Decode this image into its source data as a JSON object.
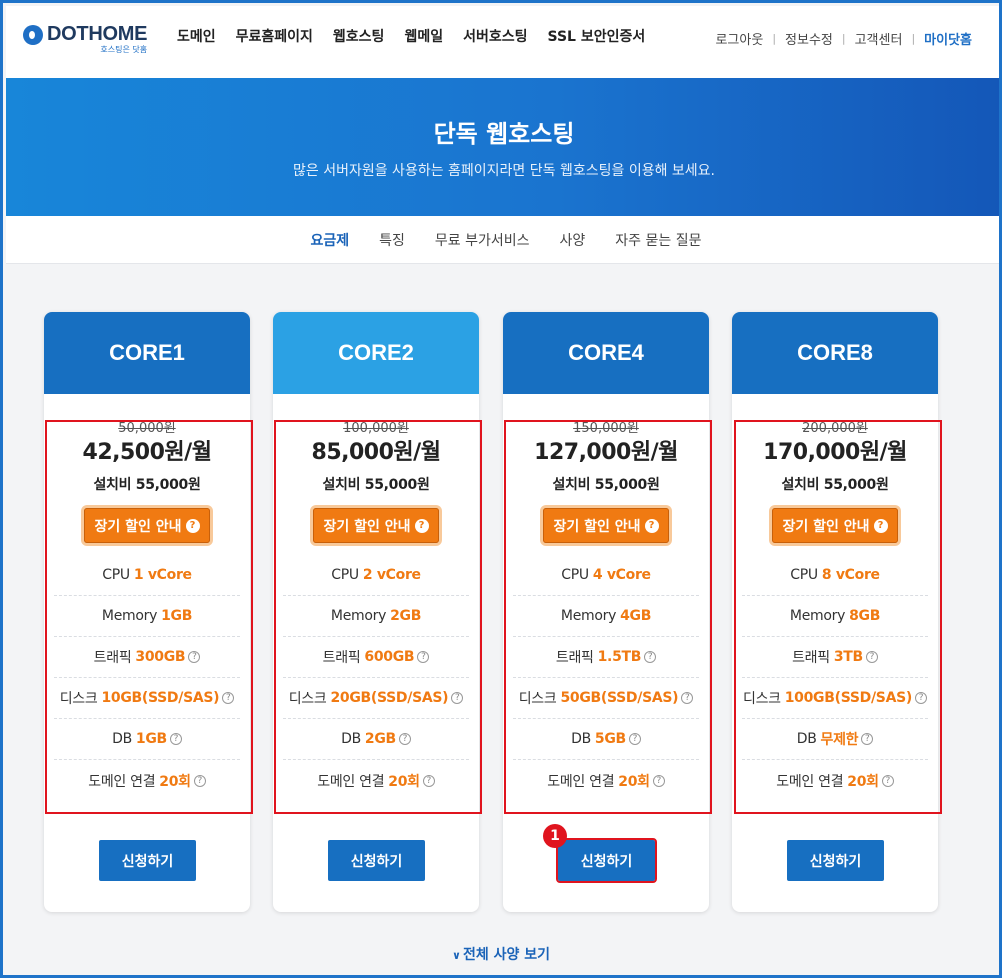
{
  "header": {
    "logo": {
      "word": "DOTHOME",
      "sub": "호스팅은 닷홈"
    },
    "nav": [
      "도메인",
      "무료홈페이지",
      "웹호스팅",
      "웹메일",
      "서버호스팅",
      "SSL 보안인증서"
    ],
    "util": {
      "logout": "로그아웃",
      "edit_info": "정보수정",
      "support": "고객센터",
      "my": "마이닷홈"
    }
  },
  "hero": {
    "title": "단독 웹호스팅",
    "subtitle": "많은 서버자원을 사용하는 홈페이지라면 단독 웹호스팅을 이용해 보세요."
  },
  "tabs": [
    "요금제",
    "특징",
    "무료 부가서비스",
    "사양",
    "자주 묻는 질문"
  ],
  "active_tab": "요금제",
  "labels": {
    "discount_button": "장기 할인 안내",
    "cpu": "CPU",
    "memory": "Memory",
    "traffic": "트래픽",
    "disk": "디스크",
    "db": "DB",
    "domain": "도메인 연결",
    "apply": "신청하기",
    "view_all": "전체 사양 보기"
  },
  "plans": [
    {
      "name": "CORE1",
      "original_price": "50,000원",
      "price": "42,500원/월",
      "setup": "설치비 55,000원",
      "cpu": "1 vCore",
      "memory": "1GB",
      "traffic": "300GB",
      "disk": "10GB(SSD/SAS)",
      "db": "1GB",
      "domain": "20회"
    },
    {
      "name": "CORE2",
      "original_price": "100,000원",
      "price": "85,000원/월",
      "setup": "설치비 55,000원",
      "cpu": "2 vCore",
      "memory": "2GB",
      "traffic": "600GB",
      "disk": "20GB(SSD/SAS)",
      "db": "2GB",
      "domain": "20회"
    },
    {
      "name": "CORE4",
      "original_price": "150,000원",
      "price": "127,000원/월",
      "setup": "설치비 55,000원",
      "cpu": "4 vCore",
      "memory": "4GB",
      "traffic": "1.5TB",
      "disk": "50GB(SSD/SAS)",
      "db": "5GB",
      "domain": "20회"
    },
    {
      "name": "CORE8",
      "original_price": "200,000원",
      "price": "170,000원/월",
      "setup": "설치비 55,000원",
      "cpu": "8 vCore",
      "memory": "8GB",
      "traffic": "3TB",
      "disk": "100GB(SSD/SAS)",
      "db": "무제한",
      "domain": "20회"
    }
  ],
  "annotation": {
    "badge": "1"
  },
  "colors": {
    "primary": "#176fc1",
    "light_header": "#2ba1e4",
    "accent": "#f07a12",
    "highlight": "#e0141e"
  }
}
